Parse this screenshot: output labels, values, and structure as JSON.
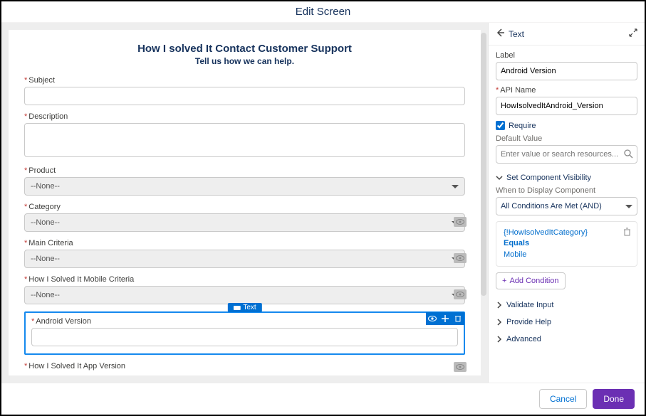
{
  "header": {
    "title": "Edit Screen"
  },
  "form": {
    "title": "How I solved It Contact Customer Support",
    "subtitle": "Tell us how we can help.",
    "fields": {
      "subject": {
        "label": "Subject"
      },
      "description": {
        "label": "Description"
      },
      "product": {
        "label": "Product",
        "value": "--None--"
      },
      "category": {
        "label": "Category",
        "value": "--None--"
      },
      "main_criteria": {
        "label": "Main Criteria",
        "value": "--None--"
      },
      "mobile_criteria": {
        "label": "How I Solved It Mobile Criteria",
        "value": "--None--"
      },
      "android_version": {
        "label": "Android Version",
        "tag": "Text"
      },
      "app_version": {
        "label": "How I Solved It App Version"
      }
    }
  },
  "sidebar": {
    "component_type": "Text",
    "label_label": "Label",
    "label_value": "Android Version",
    "api_label": "API Name",
    "api_value": "HowIsolvedItAndroid_Version",
    "require_label": "Require",
    "default_label": "Default Value",
    "default_placeholder": "Enter value or search resources...",
    "visibility_section": "Set Component Visibility",
    "when_label": "When to Display Component",
    "when_value": "All Conditions Are Met (AND)",
    "condition": {
      "resource": "{!HowIsolvedItCategory}",
      "operator": "Equals",
      "value": "Mobile"
    },
    "add_condition": "Add Condition",
    "sections": {
      "validate": "Validate Input",
      "help": "Provide Help",
      "advanced": "Advanced"
    }
  },
  "footer": {
    "cancel": "Cancel",
    "done": "Done"
  }
}
